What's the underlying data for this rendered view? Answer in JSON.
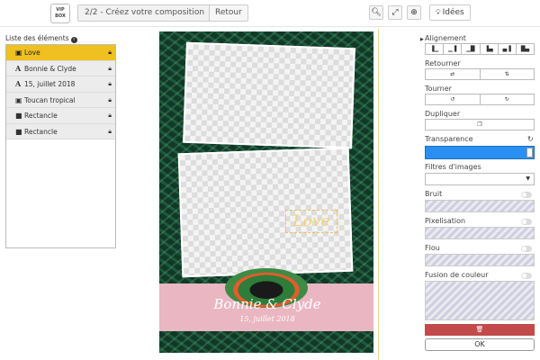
{
  "topbar": {
    "logo_line1": "VIP",
    "logo_line2": "BOX",
    "step_label": "2/2 - Créez votre composition",
    "back_label": "Retour",
    "zoom_out_icon": "zoom-out-icon",
    "fit_icon": "fit-screen-icon",
    "zoom_in_icon": "zoom-in-icon",
    "ideas_label": "Idées"
  },
  "layers": {
    "title": "Liste des éléments",
    "items": [
      {
        "label": "Love",
        "type": "image",
        "selected": true
      },
      {
        "label": "Bonnie & Clyde",
        "type": "text",
        "selected": false
      },
      {
        "label": "15, juillet 2018",
        "type": "text",
        "selected": false
      },
      {
        "label": "Toucan tropical",
        "type": "image",
        "selected": false
      },
      {
        "label": "Rectancle",
        "type": "shape",
        "selected": false
      },
      {
        "label": "Rectancle",
        "type": "shape",
        "selected": false
      }
    ]
  },
  "canvas": {
    "love_text": "Love",
    "names_text": "Bonnie & Clyde",
    "date_text": "15, juillet 2018"
  },
  "props": {
    "alignment_label": "Alignement",
    "flip_label": "Retourner",
    "rotate_label": "Tourner",
    "duplicate_label": "Dupliquer",
    "transparency_label": "Transparence",
    "transparency_value": 1.0,
    "image_filters_label": "Filtres d'images",
    "noise_label": "Bruit",
    "pixelate_label": "Pixelisation",
    "blur_label": "Flou",
    "color_blend_label": "Fusion de couleur",
    "ok_label": "OK"
  },
  "colors": {
    "selected_layer": "#f0c020",
    "transparency_bar": "#2a8ff2",
    "delete_button": "#c24a4a",
    "banner_pink": "#e9b6c2"
  }
}
